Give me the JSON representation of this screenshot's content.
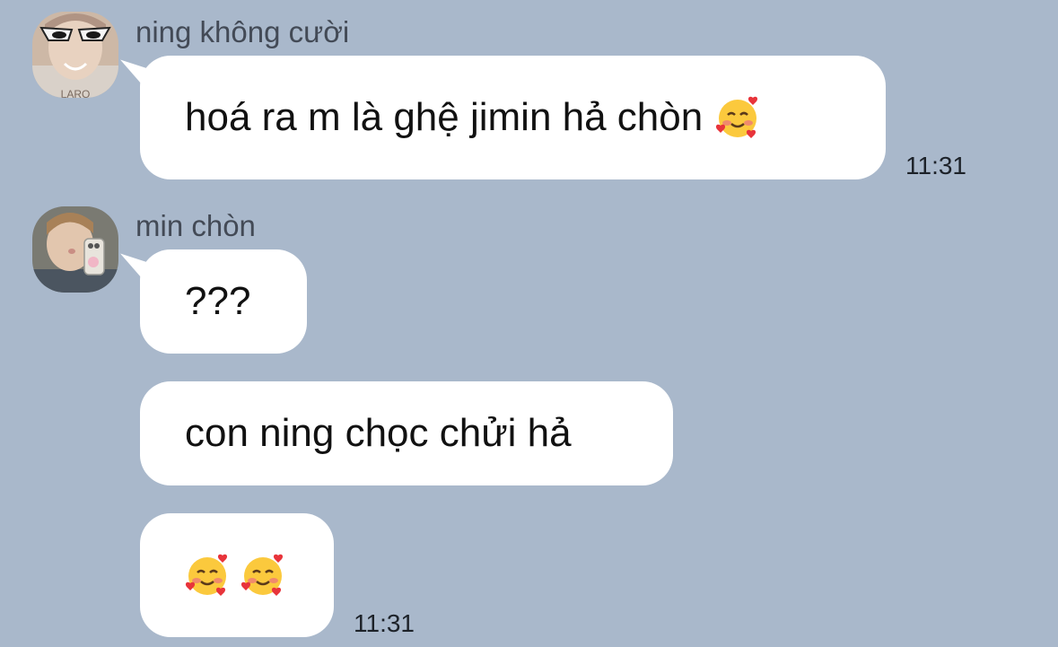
{
  "theme": {
    "background": "#a9b8cb",
    "bubble": "#ffffff",
    "name_color": "#434a56",
    "time_color": "#1d2229"
  },
  "messages": [
    {
      "sender": "ning không cười",
      "avatar": "profile-photo-sunglasses",
      "bubbles": [
        {
          "text": "hoá ra m là ghệ jimin hả chòn",
          "emoji": "smiling-face-with-hearts"
        }
      ],
      "time": "11:31"
    },
    {
      "sender": "min chòn",
      "avatar": "profile-photo-mirror-selfie",
      "bubbles": [
        {
          "text": "???"
        },
        {
          "text": "con ning chọc chửi hả"
        },
        {
          "emoji": [
            "smiling-face-with-hearts",
            "smiling-face-with-hearts"
          ]
        }
      ],
      "time": "11:31"
    }
  ]
}
